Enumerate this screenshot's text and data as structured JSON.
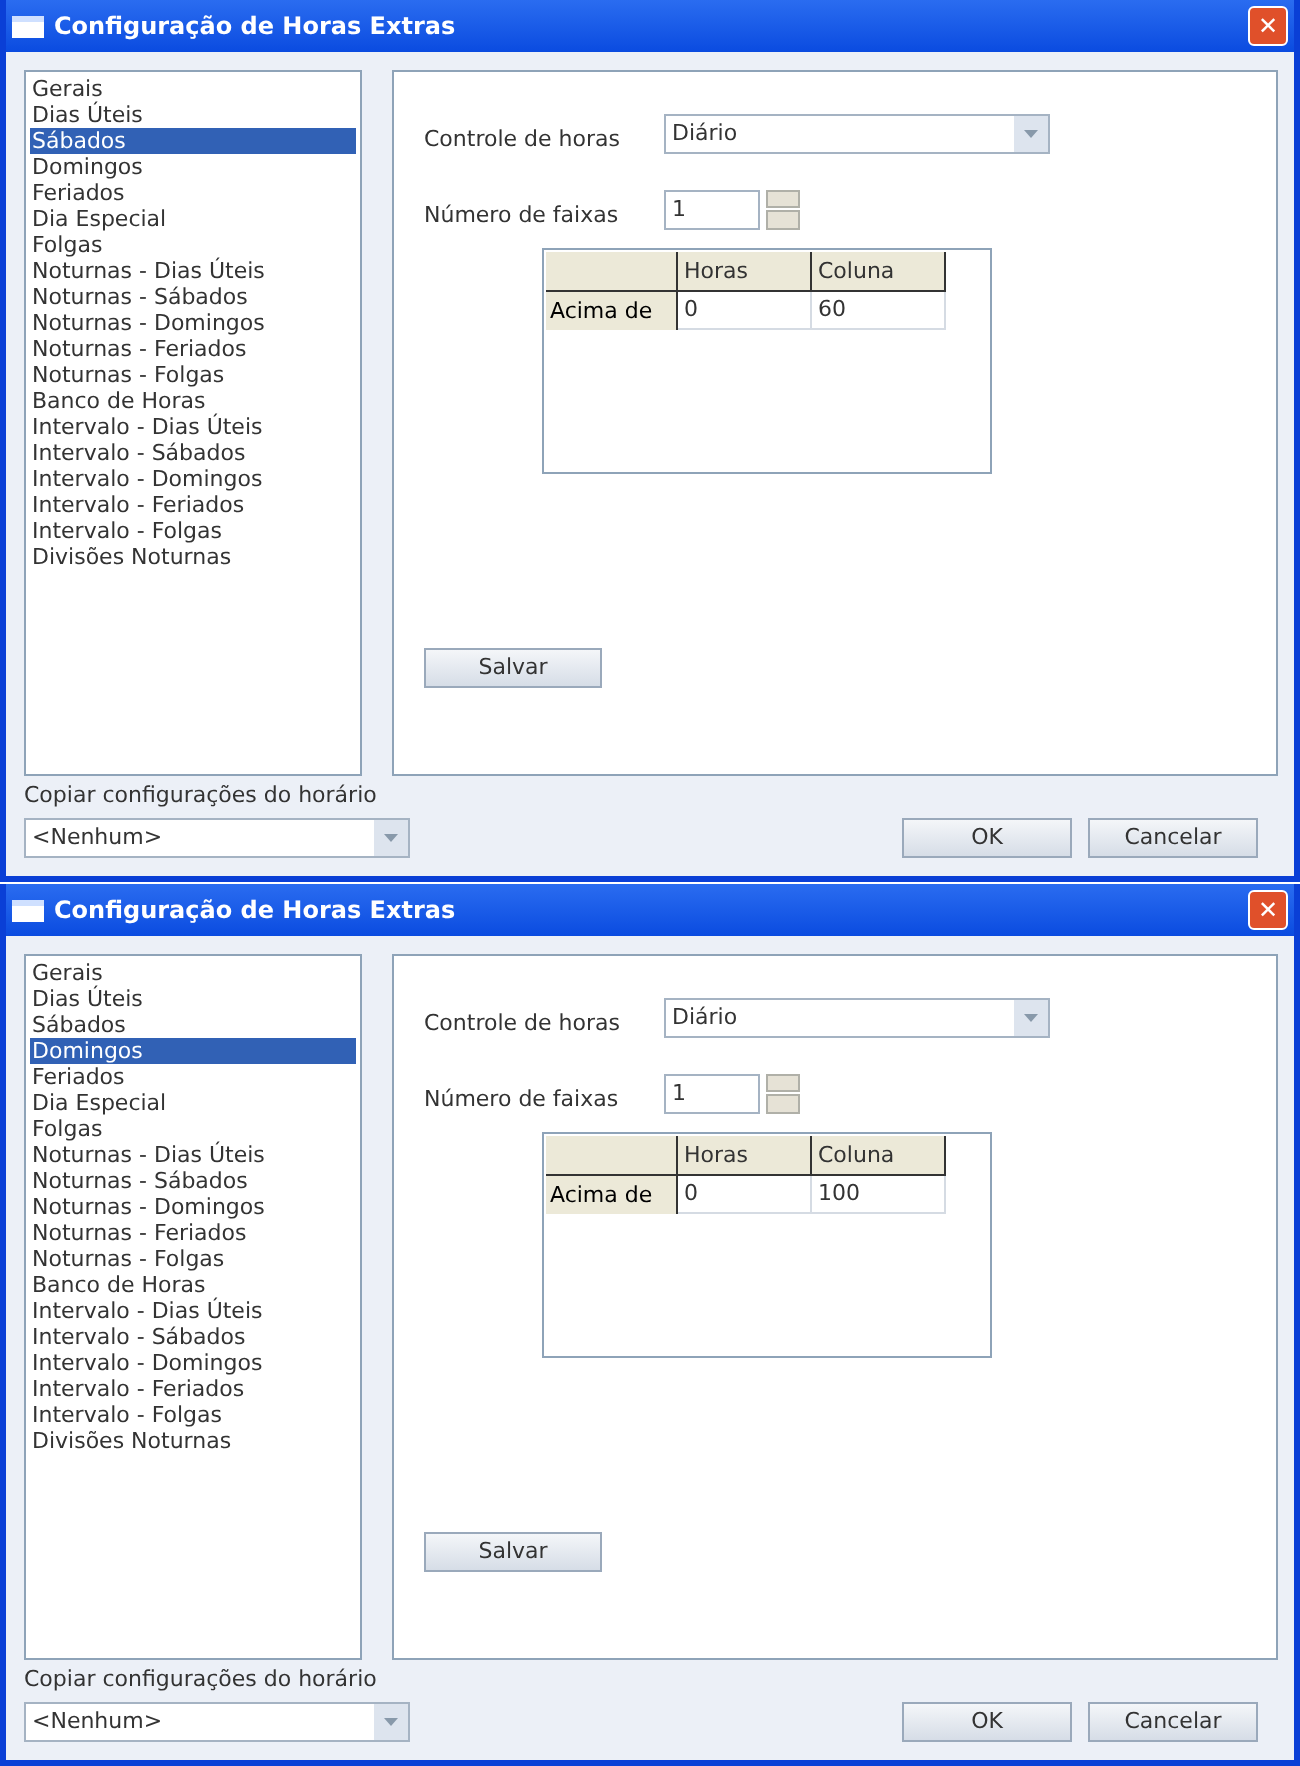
{
  "dialogs": [
    {
      "title": "Configuração de Horas Extras",
      "close": "✕",
      "nav_items": [
        {
          "label": "Gerais",
          "selected": false
        },
        {
          "label": "Dias Úteis",
          "selected": false
        },
        {
          "label": "Sábados",
          "selected": true
        },
        {
          "label": "Domingos",
          "selected": false
        },
        {
          "label": "Feriados",
          "selected": false
        },
        {
          "label": "Dia Especial",
          "selected": false
        },
        {
          "label": "Folgas",
          "selected": false
        },
        {
          "label": "Noturnas - Dias Úteis",
          "selected": false
        },
        {
          "label": "Noturnas - Sábados",
          "selected": false
        },
        {
          "label": "Noturnas - Domingos",
          "selected": false
        },
        {
          "label": "Noturnas - Feriados",
          "selected": false
        },
        {
          "label": "Noturnas - Folgas",
          "selected": false
        },
        {
          "label": "Banco de Horas",
          "selected": false
        },
        {
          "label": "Intervalo - Dias Úteis",
          "selected": false
        },
        {
          "label": "Intervalo - Sábados",
          "selected": false
        },
        {
          "label": "Intervalo - Domingos",
          "selected": false
        },
        {
          "label": "Intervalo - Feriados",
          "selected": false
        },
        {
          "label": "Intervalo - Folgas",
          "selected": false
        },
        {
          "label": "Divisões Noturnas",
          "selected": false
        }
      ],
      "controle_label": "Controle de horas",
      "controle_value": "Diário",
      "faixas_label": "Número de faixas",
      "faixas_value": "1",
      "table": {
        "columns": [
          "Horas",
          "Coluna"
        ],
        "rows": [
          {
            "header": "Acima de",
            "cells": [
              "0",
              "60"
            ]
          }
        ]
      },
      "save_button": "Salvar",
      "copy_label": "Copiar configurações do horário",
      "copy_value": "<Nenhum>",
      "buttons": [
        "OK",
        "Cancelar"
      ]
    },
    {
      "title": "Configuração de Horas Extras",
      "close": "✕",
      "nav_items": [
        {
          "label": "Gerais",
          "selected": false
        },
        {
          "label": "Dias Úteis",
          "selected": false
        },
        {
          "label": "Sábados",
          "selected": false
        },
        {
          "label": "Domingos",
          "selected": true
        },
        {
          "label": "Feriados",
          "selected": false
        },
        {
          "label": "Dia Especial",
          "selected": false
        },
        {
          "label": "Folgas",
          "selected": false
        },
        {
          "label": "Noturnas - Dias Úteis",
          "selected": false
        },
        {
          "label": "Noturnas - Sábados",
          "selected": false
        },
        {
          "label": "Noturnas - Domingos",
          "selected": false
        },
        {
          "label": "Noturnas - Feriados",
          "selected": false
        },
        {
          "label": "Noturnas - Folgas",
          "selected": false
        },
        {
          "label": "Banco de Horas",
          "selected": false
        },
        {
          "label": "Intervalo - Dias Úteis",
          "selected": false
        },
        {
          "label": "Intervalo - Sábados",
          "selected": false
        },
        {
          "label": "Intervalo - Domingos",
          "selected": false
        },
        {
          "label": "Intervalo - Feriados",
          "selected": false
        },
        {
          "label": "Intervalo - Folgas",
          "selected": false
        },
        {
          "label": "Divisões Noturnas",
          "selected": false
        }
      ],
      "controle_label": "Controle de horas",
      "controle_value": "Diário",
      "faixas_label": "Número de faixas",
      "faixas_value": "1",
      "table": {
        "columns": [
          "Horas",
          "Coluna"
        ],
        "rows": [
          {
            "header": "Acima de",
            "cells": [
              "0",
              "100"
            ]
          }
        ]
      },
      "save_button": "Salvar",
      "copy_label": "Copiar configurações do horário",
      "copy_value": "<Nenhum>",
      "buttons": [
        "OK",
        "Cancelar"
      ]
    }
  ]
}
